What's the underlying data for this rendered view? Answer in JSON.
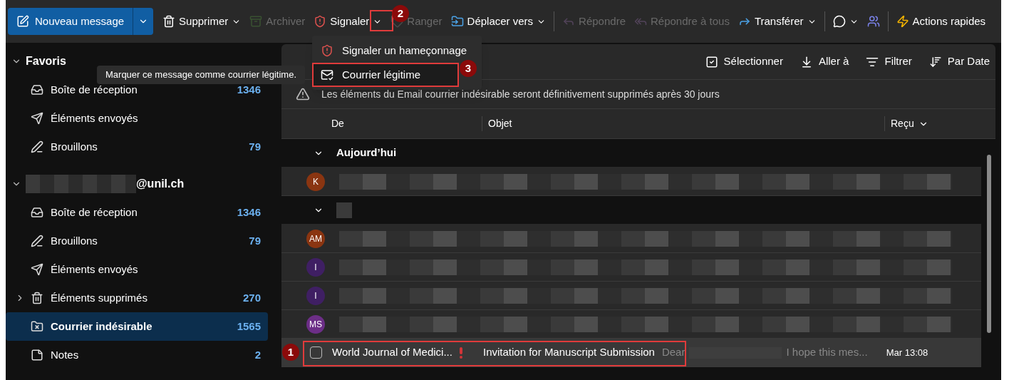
{
  "toolbar": {
    "new_message": {
      "label": "Nouveau message"
    },
    "groups": [
      [
        {
          "label": "Supprimer",
          "caret": true,
          "disabled": false
        },
        {
          "label": "Archiver",
          "caret": false,
          "disabled": true
        },
        {
          "label": "Signaler",
          "caret": true,
          "disabled": false
        },
        {
          "label": "Ranger",
          "caret": false,
          "disabled": true
        },
        {
          "label": "Déplacer vers",
          "caret": true,
          "disabled": false
        }
      ],
      [
        {
          "label": "Répondre",
          "caret": false,
          "disabled": true
        },
        {
          "label": "Répondre à tous",
          "caret": false,
          "disabled": true
        },
        {
          "label": "Transférer",
          "caret": true,
          "disabled": false
        }
      ],
      [
        {
          "caret": true,
          "disabled": false
        },
        {
          "caret": false,
          "disabled": false
        }
      ],
      [
        {
          "label": "Actions rapides",
          "caret": false,
          "disabled": false
        }
      ]
    ]
  },
  "report_menu": {
    "items": [
      {
        "label": "Signaler un hameçonnage",
        "selected": false
      },
      {
        "label": "Courrier légitime",
        "selected": true
      }
    ]
  },
  "tooltip": "Marquer ce message comme courrier légitime.",
  "sidebar": {
    "sections": [
      {
        "title": "Favoris",
        "expanded": true,
        "items": [
          {
            "label": "Boîte de réception",
            "count": "1346",
            "selected": false
          },
          {
            "label": "Éléments envoyés",
            "selected": false
          },
          {
            "label": "Brouillons",
            "count": "79",
            "selected": false
          }
        ]
      },
      {
        "title": "@unil.ch",
        "expanded": true,
        "items": [
          {
            "label": "Boîte de réception",
            "count": "1346",
            "selected": false
          },
          {
            "label": "Brouillons",
            "count": "79",
            "selected": false
          },
          {
            "label": "Éléments envoyés",
            "selected": false
          },
          {
            "label": "Éléments supprimés",
            "count": "270",
            "selected": false,
            "expandable": true
          },
          {
            "label": "Courrier indésirable",
            "count": "1565",
            "selected": true
          },
          {
            "label": "Notes",
            "count": "2",
            "selected": false
          }
        ]
      }
    ]
  },
  "list_toolbar": [
    "Sélectionner",
    "Aller à",
    "Filtrer",
    "Par Date"
  ],
  "banner": "Les éléments du Email courrier indésirable seront définitivement supprimés après 30 jours",
  "columns": [
    "De",
    "Objet",
    "Reçu"
  ],
  "rows": [
    {
      "kind": "group",
      "label": "Aujourd’hui"
    },
    {
      "kind": "message",
      "initials": "K",
      "color": "#8a3511",
      "selected": false
    },
    {
      "kind": "group"
    },
    {
      "kind": "message",
      "initials": "AM",
      "color": "#8a3511",
      "selected": false
    },
    {
      "kind": "message",
      "initials": "I",
      "color": "#3f1f63",
      "selected": false
    },
    {
      "kind": "message",
      "initials": "I",
      "color": "#3f1f63",
      "selected": false
    },
    {
      "kind": "message",
      "initials": "MS",
      "color": "#6c2e87",
      "selected": false
    },
    {
      "kind": "open",
      "selected": true,
      "sender": "World Journal of Medici...",
      "important": true,
      "subject": "Invitation for Manuscript Submission",
      "preview_start": "Dear",
      "preview_end": "I hope this mes...",
      "time": "Mar 13:08",
      "checked": false
    }
  ],
  "annotations": [
    "1",
    "2",
    "3"
  ]
}
